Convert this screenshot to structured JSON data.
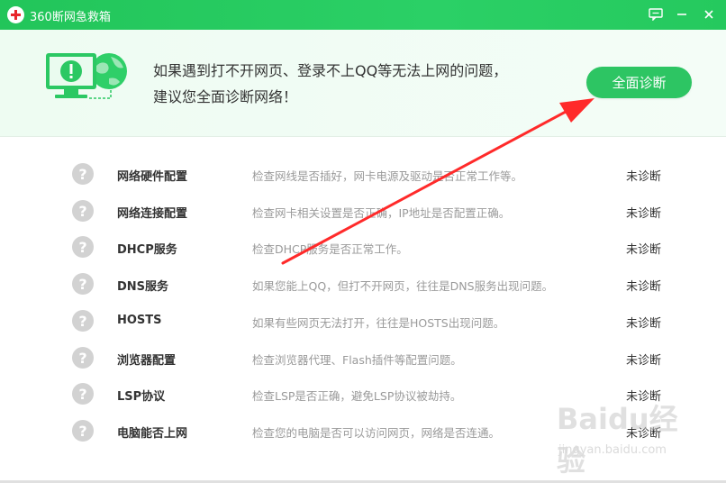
{
  "window": {
    "title": "360断网急救箱",
    "feedback_icon": "feedback-icon",
    "minimize_icon": "minimize-icon",
    "close_icon": "close-icon"
  },
  "banner": {
    "line1": "如果遇到打不开网页、登录不上QQ等无法上网的问题，",
    "line2": "建议您全面诊断网络！",
    "diagnose_button": "全面诊断"
  },
  "items": [
    {
      "name": "网络硬件配置",
      "desc": "检查网线是否插好，网卡电源及驱动是否正常工作等。",
      "status": "未诊断"
    },
    {
      "name": "网络连接配置",
      "desc": "检查网卡相关设置是否正确，IP地址是否配置正确。",
      "status": "未诊断"
    },
    {
      "name": "DHCP服务",
      "desc": "检查DHCP服务是否正常工作。",
      "status": "未诊断"
    },
    {
      "name": "DNS服务",
      "desc": "如果您能上QQ，但打不开网页，往往是DNS服务出现问题。",
      "status": "未诊断"
    },
    {
      "name": "HOSTS",
      "desc": "如果有些网页无法打开，往往是HOSTS出现问题。",
      "status": "未诊断"
    },
    {
      "name": "浏览器配置",
      "desc": "检查浏览器代理、Flash插件等配置问题。",
      "status": "未诊断"
    },
    {
      "name": "LSP协议",
      "desc": "检查LSP是否正确，避免LSP协议被劫持。",
      "status": "未诊断"
    },
    {
      "name": "电脑能否上网",
      "desc": "检查您的电脑是否可以访问网页，网络是否连通。",
      "status": "未诊断"
    }
  ],
  "watermark": {
    "brand": "Baidu经验",
    "url": "jingyan.baidu.com"
  },
  "colors": {
    "accent": "#2dc563",
    "titlebar": "#25c95e",
    "arrow": "#ff2a2a"
  }
}
